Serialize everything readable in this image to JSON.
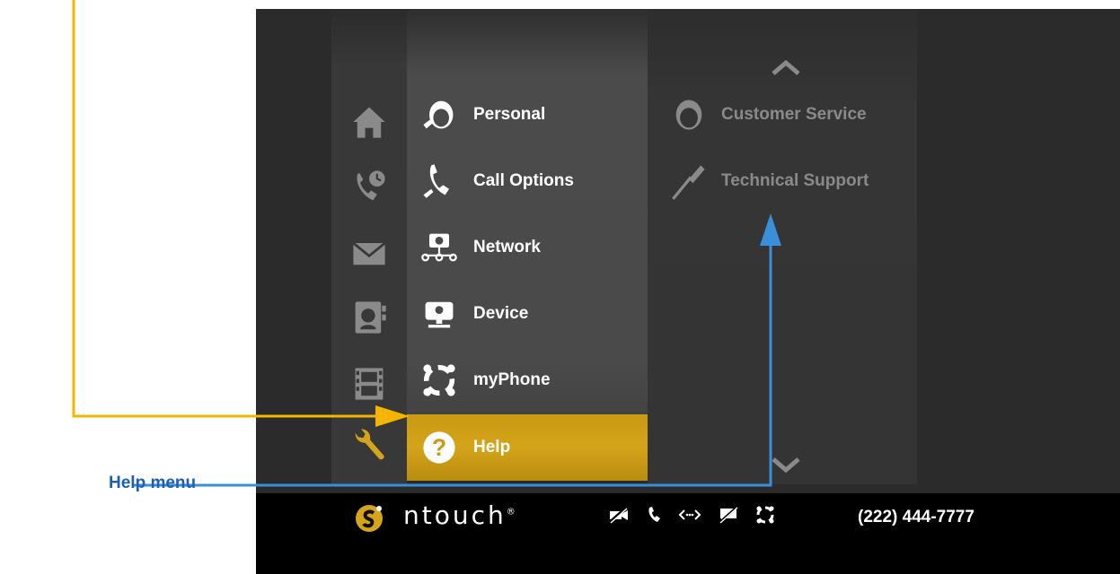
{
  "nav_rail": {
    "icons": [
      "home-icon",
      "call-history-icon",
      "messages-icon",
      "contacts-icon",
      "video-center-icon",
      "settings-wrench-icon"
    ]
  },
  "menu": {
    "items": [
      {
        "label": "Personal",
        "icon": "personal-settings-icon"
      },
      {
        "label": "Call Options",
        "icon": "call-options-icon"
      },
      {
        "label": "Network",
        "icon": "network-icon"
      },
      {
        "label": "Device",
        "icon": "device-icon"
      },
      {
        "label": "myPhone",
        "icon": "myphone-icon"
      },
      {
        "label": "Help",
        "icon": "help-icon",
        "selected": true
      }
    ]
  },
  "submenu": {
    "items": [
      {
        "label": "Customer Service",
        "icon": "customer-service-icon"
      },
      {
        "label": "Technical Support",
        "icon": "screwdriver-icon"
      }
    ]
  },
  "statusbar": {
    "brand": "ntouch",
    "brand_mark": "®",
    "icons": [
      "video-off-icon",
      "phone-icon",
      "signal-icon",
      "message-off-icon",
      "myphone-status-icon"
    ],
    "phone_number": "(222) 444-7777"
  },
  "annotations": {
    "callout_label": "Help menu"
  },
  "colors": {
    "accent": "#d4a41a",
    "callout_yellow": "#f5b400",
    "callout_blue": "#3a8fd9",
    "callout_text": "#1f5fb2"
  }
}
